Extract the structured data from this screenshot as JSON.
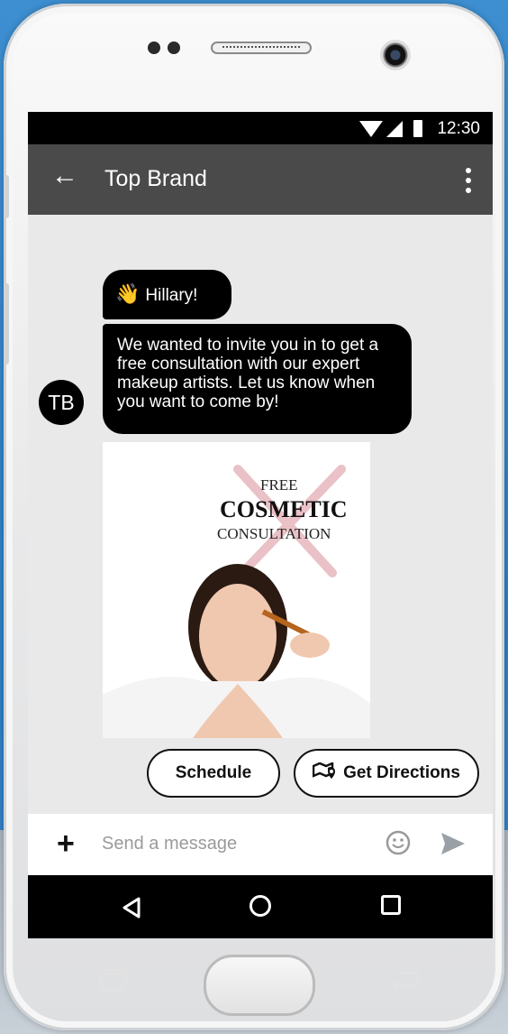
{
  "status_bar": {
    "time": "12:30"
  },
  "app_bar": {
    "back_icon": "arrow-left-icon",
    "title": "Top Brand",
    "menu_icon": "more-vert-icon"
  },
  "conversation": {
    "avatar_initials": "TB",
    "messages": [
      {
        "emoji": "👋",
        "text": "Hillary!"
      },
      {
        "text": "We wanted to invite you in to get a free consultation with our expert makeup artists. Let us know when you want to come by!"
      }
    ],
    "card": {
      "line1": "FREE",
      "line2": "COSMETIC",
      "line3": "CONSULTATION"
    },
    "suggestions": [
      {
        "label": "Schedule"
      },
      {
        "label": "Get Directions",
        "icon": "map-pin-icon"
      }
    ]
  },
  "composer": {
    "placeholder": "Send a message",
    "add_icon": "plus-icon",
    "emoji_icon": "smiley-icon",
    "send_icon": "send-icon"
  },
  "colors": {
    "app_bar": "#4a4a4a",
    "bubble": "#000000",
    "chat_bg": "#e9e9e9",
    "placeholder": "#9a9a9a"
  }
}
